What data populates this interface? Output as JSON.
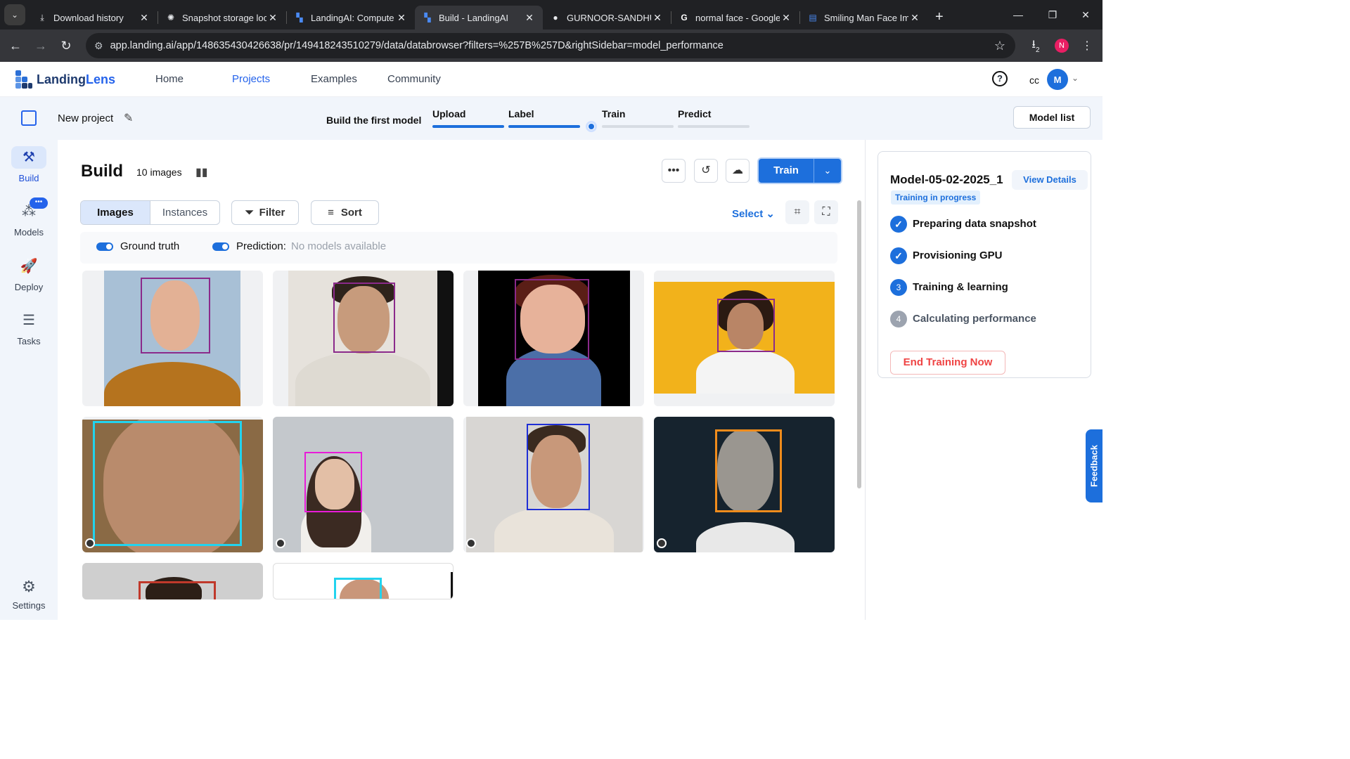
{
  "browser": {
    "tabs": [
      {
        "title": "Download history",
        "icon": "download-icon"
      },
      {
        "title": "Snapshot storage loc",
        "icon": "openai-icon"
      },
      {
        "title": "LandingAI: Compute",
        "icon": "landing-icon"
      },
      {
        "title": "Build - LandingAI",
        "icon": "landing-icon",
        "active": true
      },
      {
        "title": "GURNOOR-SANDHU",
        "icon": "github-icon"
      },
      {
        "title": "normal face - Google",
        "icon": "google-icon"
      },
      {
        "title": "Smiling Man Face Im",
        "icon": "doc-icon"
      }
    ],
    "url": "app.landing.ai/app/148635430426638/pr/149418243510279/data/databrowser?filters=%257B%257D&rightSidebar=model_performance",
    "profile_initial": "N",
    "downloads_count": "2"
  },
  "app_header": {
    "logo_part1": "Landing",
    "logo_part2": "Lens",
    "nav": [
      "Home",
      "Projects",
      "Examples",
      "Community"
    ],
    "active_nav": "Projects",
    "help": "?",
    "org": "cc",
    "avatar": "M"
  },
  "project_bar": {
    "name": "New project",
    "build_first": "Build the first model",
    "steps": [
      "Upload",
      "Label",
      "Train",
      "Predict"
    ],
    "model_list": "Model list"
  },
  "left_nav": {
    "items": [
      "Build",
      "Models",
      "Deploy",
      "Tasks"
    ],
    "settings": "Settings",
    "models_badge": "•••"
  },
  "main": {
    "title": "Build",
    "image_count": "10 images",
    "train_label": "Train",
    "tabs": [
      "Images",
      "Instances"
    ],
    "filter": "Filter",
    "sort": "Sort",
    "select": "Select",
    "ground_truth": "Ground truth",
    "prediction_label": "Prediction:",
    "prediction_value": "No models available"
  },
  "right_panel": {
    "model_name": "Model-05-02-2025_1",
    "view_details": "View Details",
    "status": "Training in progress",
    "steps": [
      {
        "label": "Preparing data snapshot",
        "state": "done",
        "num": "✓"
      },
      {
        "label": "Provisioning GPU",
        "state": "done",
        "num": "✓"
      },
      {
        "label": "Training & learning",
        "state": "current",
        "num": "3"
      },
      {
        "label": "Calculating performance",
        "state": "todo",
        "num": "4"
      }
    ],
    "end_training": "End Training Now"
  },
  "feedback": "Feedback",
  "colors": {
    "accent": "#1d6fdc",
    "bbox_purple": "#8b2a8b",
    "bbox_cyan": "#22d3ee",
    "bbox_magenta": "#e81cd8",
    "bbox_blue": "#1f2fd6",
    "bbox_orange": "#f08c1c",
    "bbox_red": "#c0392b"
  }
}
